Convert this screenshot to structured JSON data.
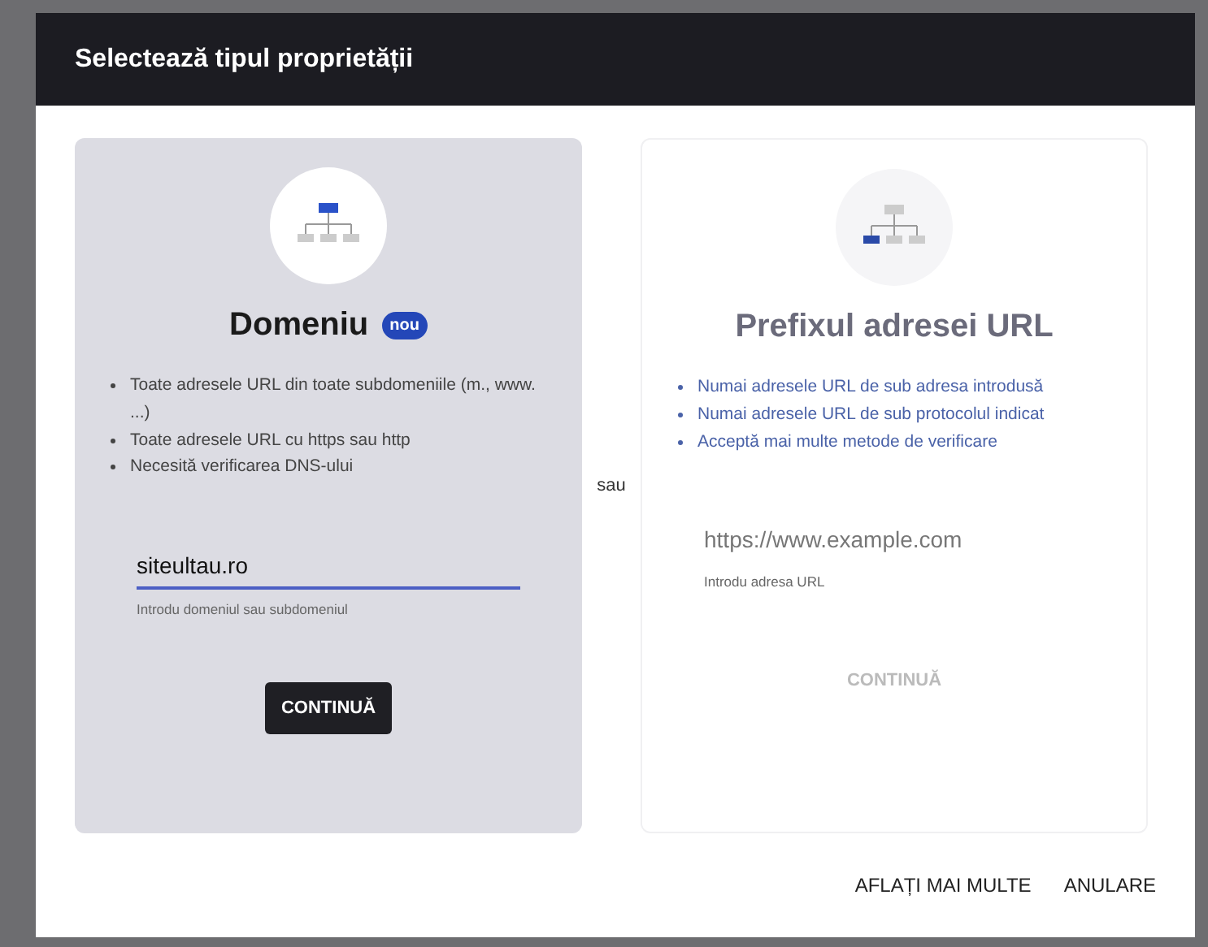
{
  "dialog": {
    "title": "Selectează tipul proprietății"
  },
  "options": [
    {
      "kind": "domain",
      "selected": true,
      "title": "Domeniu",
      "badge": "nou",
      "bullets": [
        "Toate adresele URL din toate subdomeniile (m., www. ...)",
        "Toate adresele URL cu https sau http",
        "Necesită verificarea DNS-ului"
      ],
      "field": {
        "value": "siteultau.ro",
        "helper": "Introdu domeniul sau subdomeniul"
      },
      "button": "CONTINUĂ"
    },
    {
      "kind": "prefix",
      "selected": false,
      "title": "Prefixul adresei URL",
      "bullets": [
        "Numai adresele URL de sub adresa introdusă",
        "Numai adresele URL de sub protocolul indicat",
        "Acceptă mai multe metode de verificare"
      ],
      "field": {
        "placeholder": "https://www.example.com",
        "helper": "Introdu adresa URL"
      },
      "button": "CONTINUĂ"
    }
  ],
  "separator": "sau",
  "footer_buttons": [
    "AFLAȚI MAI MULTE",
    "ANULARE"
  ]
}
